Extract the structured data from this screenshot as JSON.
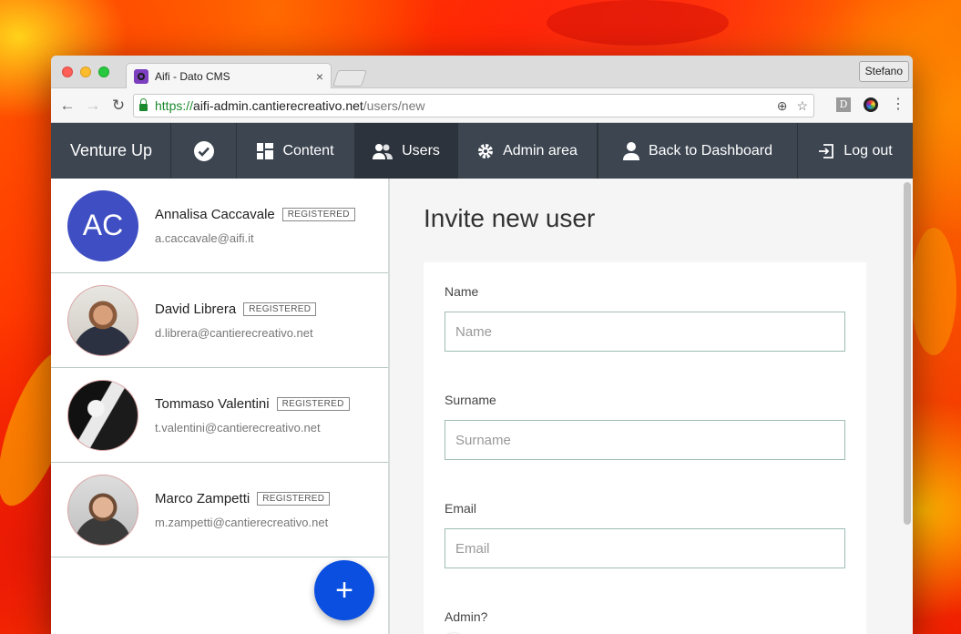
{
  "browser": {
    "tab_title": "Aifi - Dato CMS",
    "tab_close": "×",
    "profile_name": "Stefano",
    "url_scheme": "https://",
    "url_host": "aifi-admin.cantierecreativo.net",
    "url_path": "/users/new",
    "ext_label": "D"
  },
  "nav": {
    "brand": "Venture Up",
    "content": "Content",
    "users": "Users",
    "admin": "Admin area",
    "dashboard": "Back to Dashboard",
    "logout": "Log out"
  },
  "users": [
    {
      "initials": "AC",
      "name": "Annalisa Caccavale",
      "badge": "REGISTERED",
      "email": "a.caccavale@aifi.it"
    },
    {
      "name": "David Librera",
      "badge": "REGISTERED",
      "email": "d.librera@cantierecreativo.net"
    },
    {
      "name": "Tommaso Valentini",
      "badge": "REGISTERED",
      "email": "t.valentini@cantierecreativo.net"
    },
    {
      "name": "Marco Zampetti",
      "badge": "REGISTERED",
      "email": "m.zampetti@cantierecreativo.net"
    }
  ],
  "add_button": "+",
  "form": {
    "title": "Invite new user",
    "name_label": "Name",
    "name_placeholder": "Name",
    "surname_label": "Surname",
    "surname_placeholder": "Surname",
    "email_label": "Email",
    "email_placeholder": "Email",
    "admin_label": "Admin?",
    "admin_value": false
  },
  "colors": {
    "nav_bg": "#3c4550",
    "fab": "#0b4fe0",
    "initials_avatar": "#3f4fc3"
  }
}
